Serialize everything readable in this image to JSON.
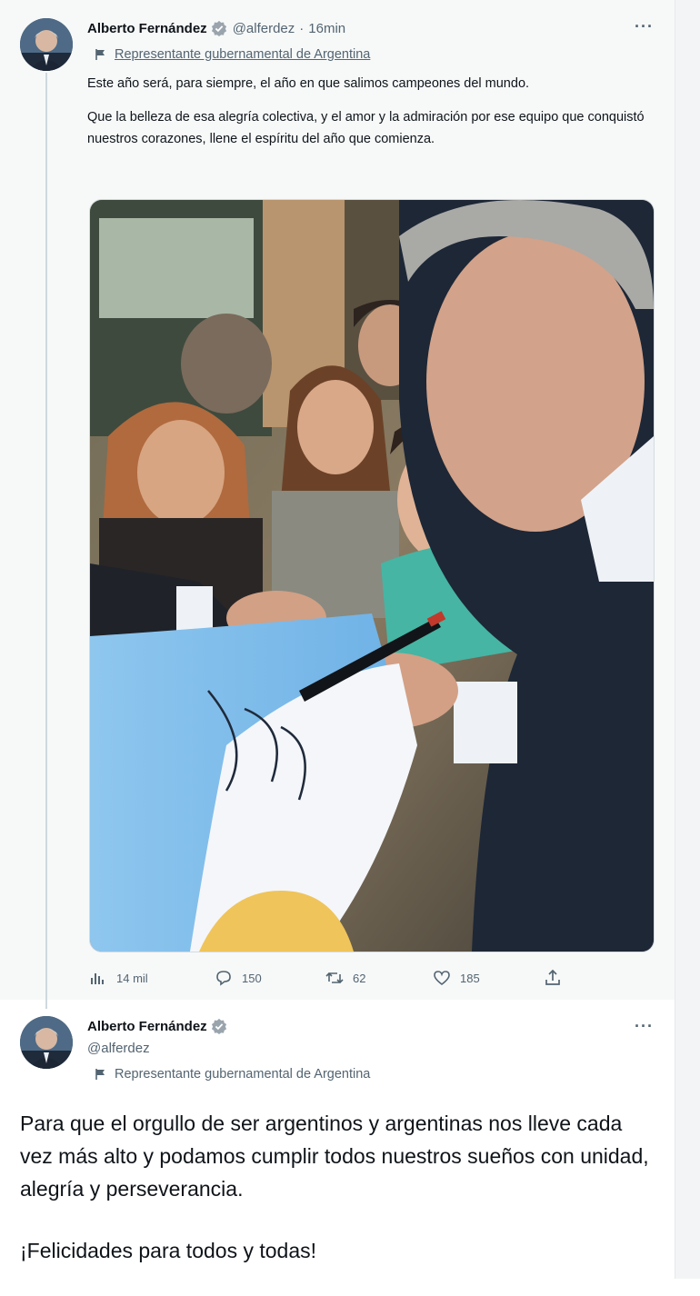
{
  "tweet1": {
    "author_name": "Alberto Fernández",
    "handle": "@alferdez",
    "separator": "·",
    "time": "16min",
    "more_label": "···",
    "gov_label": "Representante gubernamental de Argentina",
    "paragraphs": [
      "Este año será, para siempre, el año en que salimos campeones del mundo.",
      "Que la belleza de esa alegría colectiva, y el amor y la admiración por ese equipo que conquistó nuestros corazones, llene el espíritu del año que comienza."
    ],
    "photo_icon": "photo-signing-flag",
    "actions": {
      "views": "14 mil",
      "replies": "150",
      "retweets": "62",
      "likes": "185"
    },
    "action_icons": [
      "views-icon",
      "reply-icon",
      "retweet-icon",
      "like-icon",
      "share-icon"
    ]
  },
  "tweet2": {
    "author_name": "Alberto Fernández",
    "handle": "@alferdez",
    "more_label": "···",
    "gov_label": "Representante gubernamental de Argentina",
    "paragraphs": [
      "Para que el orgullo de ser argentinos y argentinas nos lleve cada vez más alto y podamos cumplir todos nuestros sueños con unidad, alegría y perseverancia.",
      "¡Felicidades para todos y todas!"
    ]
  },
  "colors": {
    "verified_blue": "#1d9bf0",
    "text_primary": "#0f1419",
    "text_muted": "#536471",
    "thread_line": "#cfd9de"
  }
}
